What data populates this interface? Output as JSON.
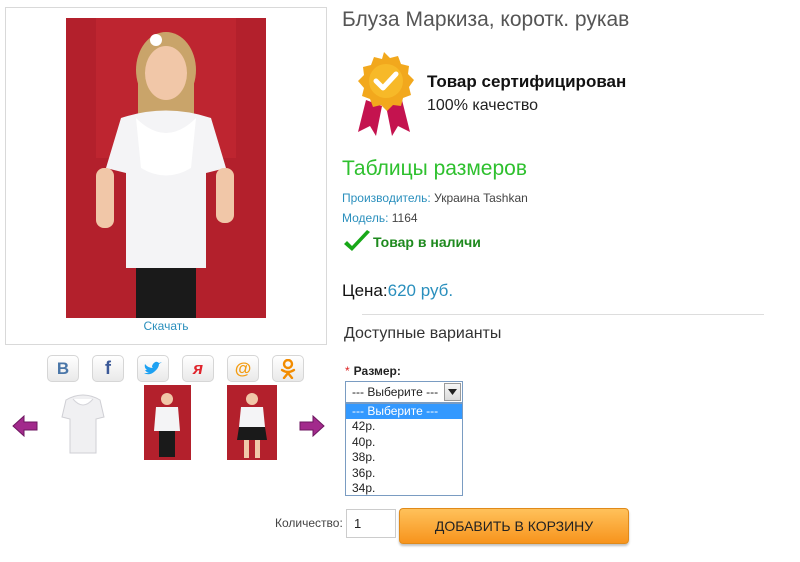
{
  "product": {
    "title": "Блуза Маркиза, коротк. рукав",
    "download_label": "Скачать"
  },
  "certification": {
    "title": "Товар сертифицирован",
    "subtitle": "100% качество"
  },
  "size_tables_label": "Таблицы размеров",
  "manufacturer": {
    "label": "Производитель:",
    "value": "Украина Tashkan"
  },
  "model": {
    "label": "Модель:",
    "value": "1164"
  },
  "stock_status": "Товар в наличи",
  "price": {
    "label": "Цена:",
    "value": "620 руб."
  },
  "options": {
    "heading": "Доступные варианты",
    "size_label": "Размер:",
    "required_mark": "*",
    "selected": "--- Выберите ---",
    "items": [
      "--- Выберите ---",
      "42р.",
      "40р.",
      "38р.",
      "36р.",
      "34р."
    ]
  },
  "quantity": {
    "label": "Количество:",
    "value": "1"
  },
  "add_to_cart_label": "ДОБАВИТЬ В КОРЗИНУ",
  "social": [
    {
      "icon": "vk-icon",
      "glyph": "B",
      "color": "#4a76a8"
    },
    {
      "icon": "facebook-icon",
      "glyph": "f",
      "color": "#3b5998"
    },
    {
      "icon": "twitter-icon",
      "glyph": "t",
      "color": "#1da1f2"
    },
    {
      "icon": "yaru-icon",
      "glyph": "я",
      "color": "#e0242c"
    },
    {
      "icon": "mailru-icon",
      "glyph": "@",
      "color": "#f39c12"
    },
    {
      "icon": "odnoklassniki-icon",
      "glyph": "ok",
      "color": "#f28c00"
    }
  ],
  "colors": {
    "accent_green": "#2ec02e",
    "link_blue": "#2a8fbd",
    "button_orange": "#f7941d",
    "stock_green": "#1e8a1e"
  }
}
